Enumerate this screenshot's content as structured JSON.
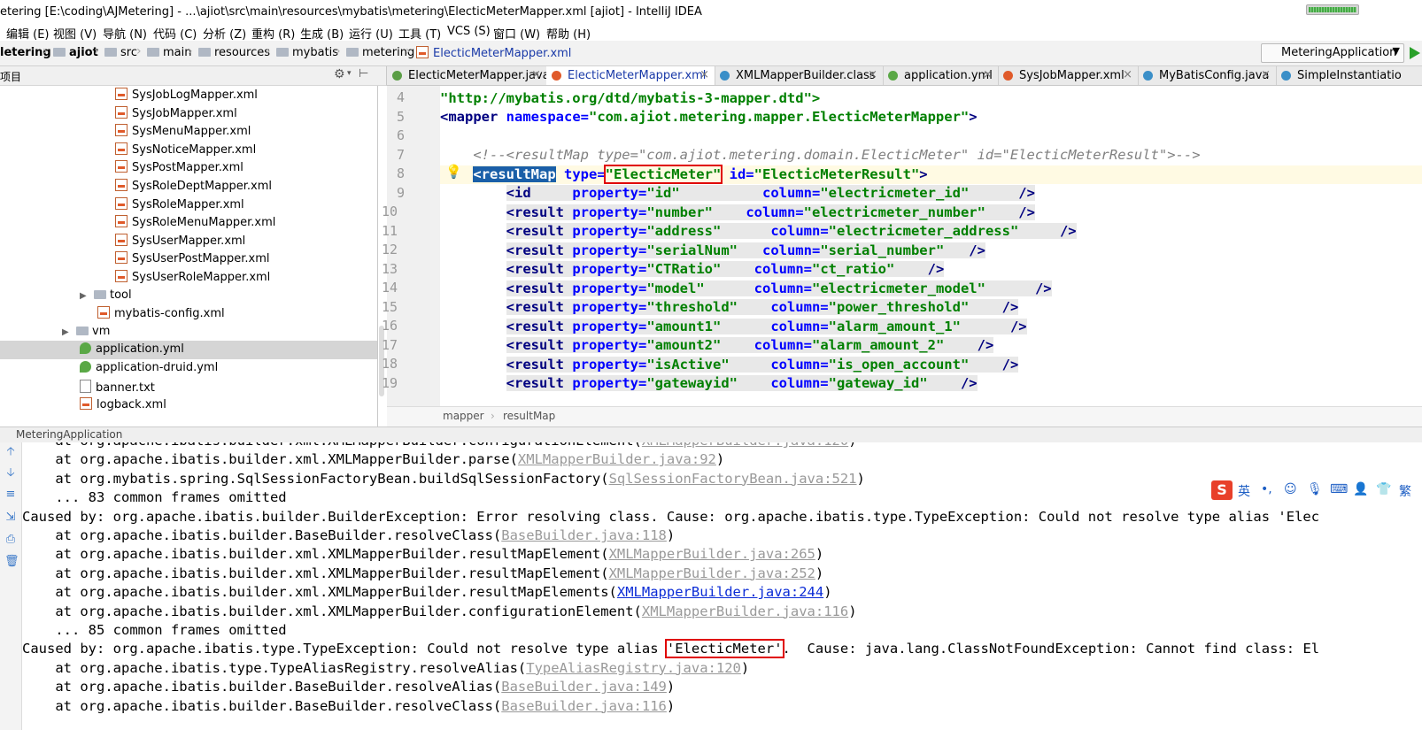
{
  "window": {
    "title": "etering [E:\\coding\\AJMetering] - ...\\ajiot\\src\\main\\resources\\mybatis\\metering\\ElecticMeterMapper.xml [ajiot] - IntelliJ IDEA"
  },
  "menu": [
    "编辑 (E)",
    "视图 (V)",
    "导航 (N)",
    "代码 (C)",
    "分析 (Z)",
    "重构 (R)",
    "生成 (B)",
    "运行 (U)",
    "工具 (T)",
    "VCS (S)",
    "窗口 (W)",
    "帮助 (H)"
  ],
  "breadcrumbs": [
    "letering",
    "ajiot",
    "src",
    "main",
    "resources",
    "mybatis",
    "metering",
    "ElecticMeterMapper.xml"
  ],
  "run_config": "MeteringApplication",
  "project_panel": {
    "title": "项目",
    "items": [
      {
        "label": "SysJobLogMapper.xml",
        "icon": "xml-file-icon"
      },
      {
        "label": "SysJobMapper.xml",
        "icon": "xml-file-icon"
      },
      {
        "label": "SysMenuMapper.xml",
        "icon": "xml-file-icon"
      },
      {
        "label": "SysNoticeMapper.xml",
        "icon": "xml-file-icon"
      },
      {
        "label": "SysPostMapper.xml",
        "icon": "xml-file-icon"
      },
      {
        "label": "SysRoleDeptMapper.xml",
        "icon": "xml-file-icon"
      },
      {
        "label": "SysRoleMapper.xml",
        "icon": "xml-file-icon"
      },
      {
        "label": "SysRoleMenuMapper.xml",
        "icon": "xml-file-icon"
      },
      {
        "label": "SysUserMapper.xml",
        "icon": "xml-file-icon"
      },
      {
        "label": "SysUserPostMapper.xml",
        "icon": "xml-file-icon"
      },
      {
        "label": "SysUserRoleMapper.xml",
        "icon": "xml-file-icon"
      },
      {
        "label": "tool",
        "icon": "folder-icon"
      },
      {
        "label": "mybatis-config.xml",
        "icon": "xml-file-icon"
      },
      {
        "label": "vm",
        "icon": "folder-icon"
      },
      {
        "label": "application.yml",
        "icon": "yml-file-icon"
      },
      {
        "label": "application-druid.yml",
        "icon": "yml-file-icon"
      },
      {
        "label": "banner.txt",
        "icon": "text-file-icon"
      },
      {
        "label": "logback.xml",
        "icon": "xml-file-icon"
      }
    ]
  },
  "tabs": [
    {
      "label": "ElecticMeterMapper.java",
      "active": false,
      "color": "#5b9e46"
    },
    {
      "label": "ElecticMeterMapper.xml",
      "active": true,
      "color": "#e05a2a"
    },
    {
      "label": "XMLMapperBuilder.class",
      "active": false,
      "color": "#3a8fc8"
    },
    {
      "label": "application.yml",
      "active": false,
      "color": "#5aa846"
    },
    {
      "label": "SysJobMapper.xml",
      "active": false,
      "color": "#e05a2a"
    },
    {
      "label": "MyBatisConfig.java",
      "active": false,
      "color": "#3a8fc8"
    },
    {
      "label": "SimpleInstantiatio",
      "active": false,
      "color": "#3a8fc8"
    }
  ],
  "editor": {
    "line_numbers": [
      "4",
      "5",
      "6",
      "7",
      "8",
      "9",
      "10",
      "11",
      "12",
      "13",
      "14",
      "15",
      "16",
      "17",
      "18",
      "19"
    ],
    "lines": {
      "l4": "\"http://mybatis.org/dtd/mybatis-3-mapper.dtd\">",
      "l5_tag": "<mapper",
      "l5_attr": " namespace=",
      "l5_val": "\"com.ajiot.metering.mapper.ElecticMeterMapper\"",
      "l5_end": ">",
      "l7": "    <!--<resultMap type=\"com.ajiot.metering.domain.ElecticMeter\" id=\"ElecticMeterResult\">-->",
      "l8_open": "<resultMap",
      "l8_type": " type=",
      "l8_typeval": "\"ElecticMeter\"",
      "l8_id": " id=",
      "l8_idval": "\"ElecticMeterResult\"",
      "l8_end": ">"
    },
    "results": [
      {
        "tag": "<id",
        "prop": "\"id\"",
        "col": "\"electricmeter_id\""
      },
      {
        "tag": "<result",
        "prop": "\"number\"",
        "col": "\"electricmeter_number\""
      },
      {
        "tag": "<result",
        "prop": "\"address\"",
        "col": "\"electricmeter_address\""
      },
      {
        "tag": "<result",
        "prop": "\"serialNum\"",
        "col": "\"serial_number\""
      },
      {
        "tag": "<result",
        "prop": "\"CTRatio\"",
        "col": "\"ct_ratio\""
      },
      {
        "tag": "<result",
        "prop": "\"model\"",
        "col": "\"electricmeter_model\""
      },
      {
        "tag": "<result",
        "prop": "\"threshold\"",
        "col": "\"power_threshold\""
      },
      {
        "tag": "<result",
        "prop": "\"amount1\"",
        "col": "\"alarm_amount_1\""
      },
      {
        "tag": "<result",
        "prop": "\"amount2\"",
        "col": "\"alarm_amount_2\""
      },
      {
        "tag": "<result",
        "prop": "\"isActive\"",
        "col": "\"is_open_account\""
      },
      {
        "tag": "<result",
        "prop": "\"gatewayid\"",
        "col": "\"gateway_id\""
      }
    ],
    "breadcrumb": [
      "mapper",
      "resultMap"
    ]
  },
  "run_panel": {
    "tab": "MeteringApplication",
    "console": [
      {
        "pre": "    at org.apache.ibatis.builder.xml.XMLMapperBuilder.configurationElement(",
        "link": "XMLMapperBuilder.java:120",
        "post": ")"
      },
      {
        "pre": "    at org.apache.ibatis.builder.xml.XMLMapperBuilder.parse(",
        "link": "XMLMapperBuilder.java:92",
        "post": ")"
      },
      {
        "pre": "    at org.mybatis.spring.SqlSessionFactoryBean.buildSqlSessionFactory(",
        "link": "SqlSessionFactoryBean.java:521",
        "post": ")"
      },
      {
        "pre": "    ... 83 common frames omitted",
        "link": "",
        "post": ""
      },
      {
        "pre": "Caused by: org.apache.ibatis.builder.BuilderException: Error resolving class. Cause: org.apache.ibatis.type.TypeException: Could not resolve type alias 'Elec",
        "link": "",
        "post": ""
      },
      {
        "pre": "    at org.apache.ibatis.builder.BaseBuilder.resolveClass(",
        "link": "BaseBuilder.java:118",
        "post": ")"
      },
      {
        "pre": "    at org.apache.ibatis.builder.xml.XMLMapperBuilder.resultMapElement(",
        "link": "XMLMapperBuilder.java:265",
        "post": ")"
      },
      {
        "pre": "    at org.apache.ibatis.builder.xml.XMLMapperBuilder.resultMapElement(",
        "link": "XMLMapperBuilder.java:252",
        "post": ")"
      },
      {
        "pre": "    at org.apache.ibatis.builder.xml.XMLMapperBuilder.resultMapElements(",
        "link": "XMLMapperBuilder.java:244",
        "post": ")"
      },
      {
        "pre": "    at org.apache.ibatis.builder.xml.XMLMapperBuilder.configurationElement(",
        "link": "XMLMapperBuilder.java:116",
        "post": ")"
      },
      {
        "pre": "    ... 85 common frames omitted",
        "link": "",
        "post": ""
      },
      {
        "pre": "Caused by: org.apache.ibatis.type.TypeException: Could not resolve type alias ",
        "link": "",
        "post": ""
      },
      {
        "pre": "    at org.apache.ibatis.type.TypeAliasRegistry.resolveAlias(",
        "link": "TypeAliasRegistry.java:120",
        "post": ")"
      },
      {
        "pre": "    at org.apache.ibatis.builder.BaseBuilder.resolveAlias(",
        "link": "BaseBuilder.java:149",
        "post": ")"
      },
      {
        "pre": "    at org.apache.ibatis.builder.BaseBuilder.resolveClass(",
        "link": "BaseBuilder.java:116",
        "post": ")"
      }
    ],
    "alias_highlight": "'ElecticMeter'",
    "alias_rest": ".  Cause: java.lang.ClassNotFoundException: Cannot find class: El"
  },
  "ime": [
    "英",
    "•,",
    "☺",
    "🎙",
    "⌨",
    "👤",
    "👕",
    "繁"
  ]
}
